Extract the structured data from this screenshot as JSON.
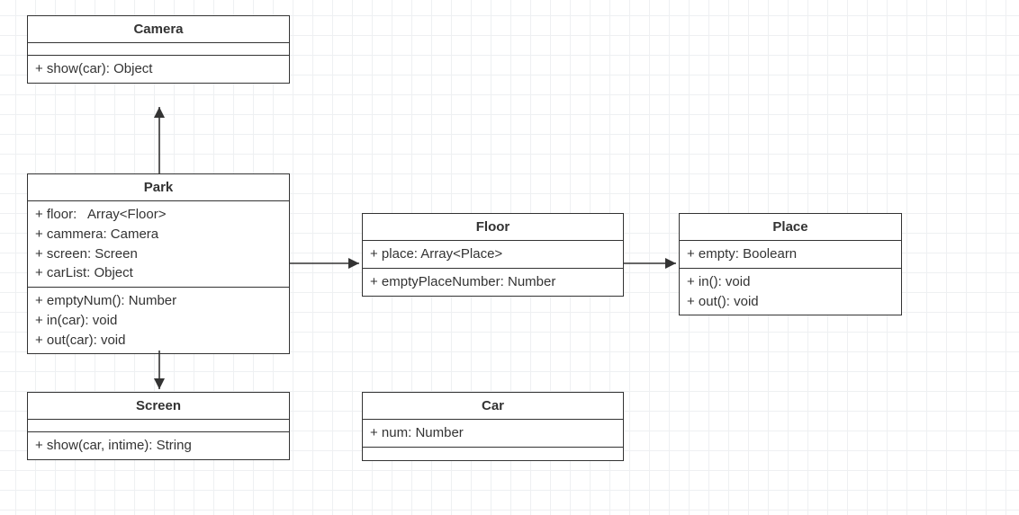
{
  "classes": {
    "camera": {
      "name": "Camera",
      "attributes": [],
      "methods": [
        "+ show(car): Object"
      ]
    },
    "park": {
      "name": "Park",
      "attributes": [
        "+ floor:   Array<Floor>",
        "+ cammera: Camera",
        "+ screen: Screen",
        "+ carList: Object"
      ],
      "methods": [
        "+ emptyNum(): Number",
        "+ in(car): void",
        "+ out(car): void"
      ]
    },
    "floor": {
      "name": "Floor",
      "attributes": [
        "+ place: Array<Place>"
      ],
      "methods": [
        "+ emptyPlaceNumber: Number"
      ]
    },
    "place": {
      "name": "Place",
      "attributes": [
        "+ empty: Boolearn"
      ],
      "methods": [
        "+ in(): void",
        "+ out(): void"
      ]
    },
    "screen": {
      "name": "Screen",
      "attributes": [],
      "methods": [
        "+ show(car, intime): String"
      ]
    },
    "car": {
      "name": "Car",
      "attributes": [
        "+ num: Number"
      ],
      "methods": []
    }
  },
  "relations": [
    {
      "from": "park",
      "to": "camera"
    },
    {
      "from": "park",
      "to": "floor"
    },
    {
      "from": "floor",
      "to": "place"
    },
    {
      "from": "park",
      "to": "screen"
    }
  ]
}
